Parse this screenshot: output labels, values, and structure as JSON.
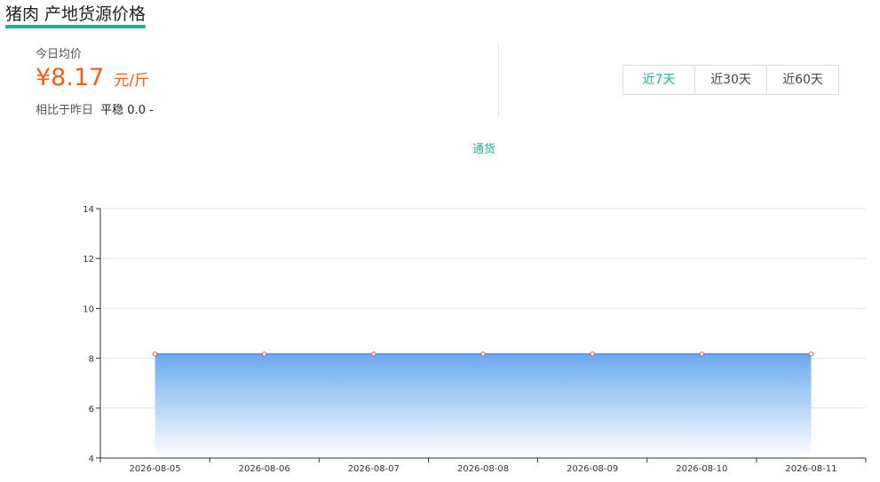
{
  "page": {
    "title": "猪肉 产地货源价格"
  },
  "summary": {
    "today_label": "今日均价",
    "price": "¥8.17",
    "unit": "元/斤",
    "compare_label": "相比于昨日",
    "trend": "平稳 0.0 -"
  },
  "range_tabs": [
    {
      "label": "近7天",
      "active": true
    },
    {
      "label": "近30天",
      "active": false
    },
    {
      "label": "近60天",
      "active": false
    }
  ],
  "colors": {
    "accent": "#1ab394",
    "price": "#f25d12",
    "series_line": "#5b9de6",
    "marker": "#e05555"
  },
  "chart_data": {
    "type": "area",
    "x": [
      "2026-08-05",
      "2026-08-06",
      "2026-08-07",
      "2026-08-08",
      "2026-08-09",
      "2026-08-10",
      "2026-08-11"
    ],
    "series": [
      {
        "name": "通货",
        "values": [
          8.17,
          8.17,
          8.17,
          8.17,
          8.17,
          8.17,
          8.17
        ]
      }
    ],
    "ylim": [
      4,
      14
    ],
    "yticks": [
      4,
      6,
      8,
      10,
      12,
      14
    ],
    "grid": true,
    "legend": "top-center"
  }
}
